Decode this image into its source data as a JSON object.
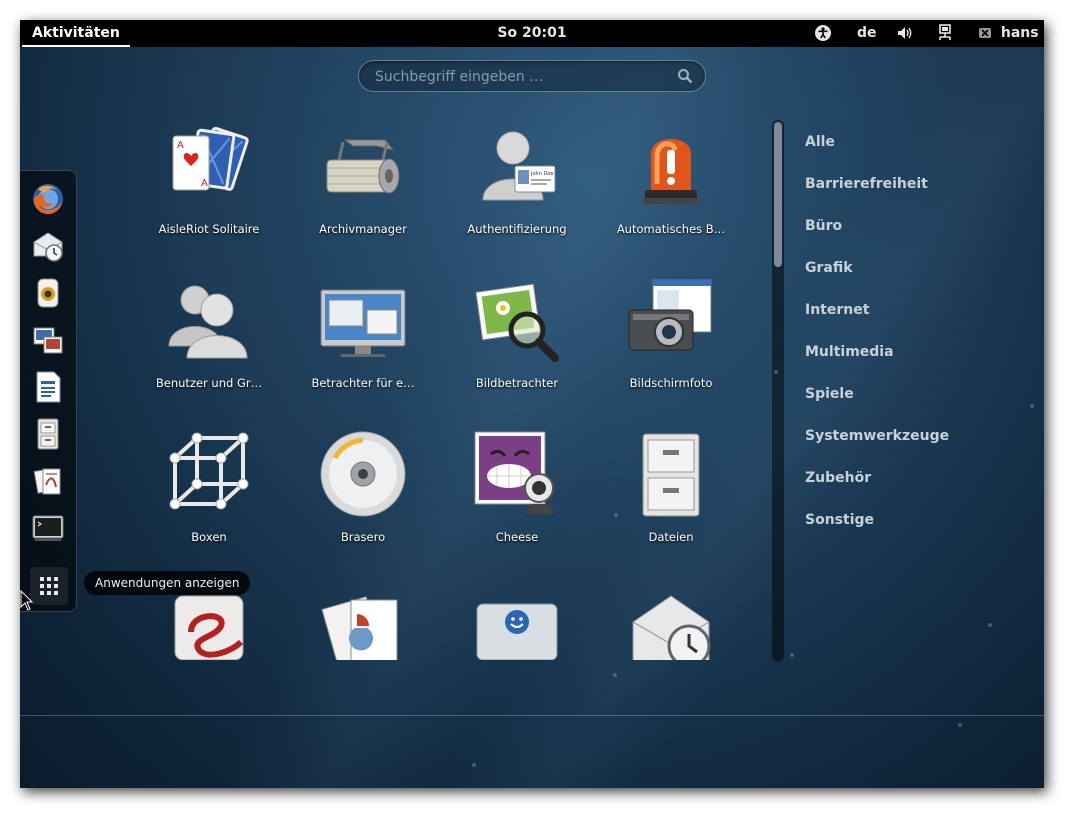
{
  "topbar": {
    "activities_label": "Aktivitäten",
    "clock": "So 20:01",
    "keyboard_layout": "de",
    "user_name": "hans"
  },
  "search": {
    "placeholder": "Suchbegriff eingeben …"
  },
  "dash": {
    "items": [
      "firefox-icon",
      "evolution-icon",
      "rhythmbox-icon",
      "shotwell-icon",
      "libreoffice-writer-icon",
      "files-icon",
      "document-viewer-icon",
      "terminal-icon"
    ],
    "show_apps_tooltip": "Anwendungen anzeigen"
  },
  "apps": [
    {
      "label": "AisleRiot Solitaire",
      "icon": "cards-icon"
    },
    {
      "label": "Archivmanager",
      "icon": "archive-manager-icon"
    },
    {
      "label": "Authentifizierung",
      "icon": "authentication-icon"
    },
    {
      "label": "Automatisches B…",
      "icon": "alarm-light-icon"
    },
    {
      "label": "Benutzer und Gr…",
      "icon": "users-groups-icon"
    },
    {
      "label": "Betrachter für e…",
      "icon": "remote-viewer-icon"
    },
    {
      "label": "Bildbetrachter",
      "icon": "image-viewer-icon"
    },
    {
      "label": "Bildschirmfoto",
      "icon": "screenshot-camera-icon"
    },
    {
      "label": "Boxen",
      "icon": "boxes-icon"
    },
    {
      "label": "Brasero",
      "icon": "brasero-disc-icon"
    },
    {
      "label": "Cheese",
      "icon": "cheese-webcam-icon"
    },
    {
      "label": "Dateien",
      "icon": "file-cabinet-icon"
    },
    {
      "label": "",
      "icon": "evolution-e-icon"
    },
    {
      "label": "",
      "icon": "office-docs-icon"
    },
    {
      "label": "",
      "icon": "contacts-icon"
    },
    {
      "label": "",
      "icon": "mail-clock-icon"
    }
  ],
  "categories": [
    "Alle",
    "Barrierefreiheit",
    "Büro",
    "Grafik",
    "Internet",
    "Multimedia",
    "Spiele",
    "Systemwerkzeuge",
    "Zubehör",
    "Sonstige"
  ]
}
